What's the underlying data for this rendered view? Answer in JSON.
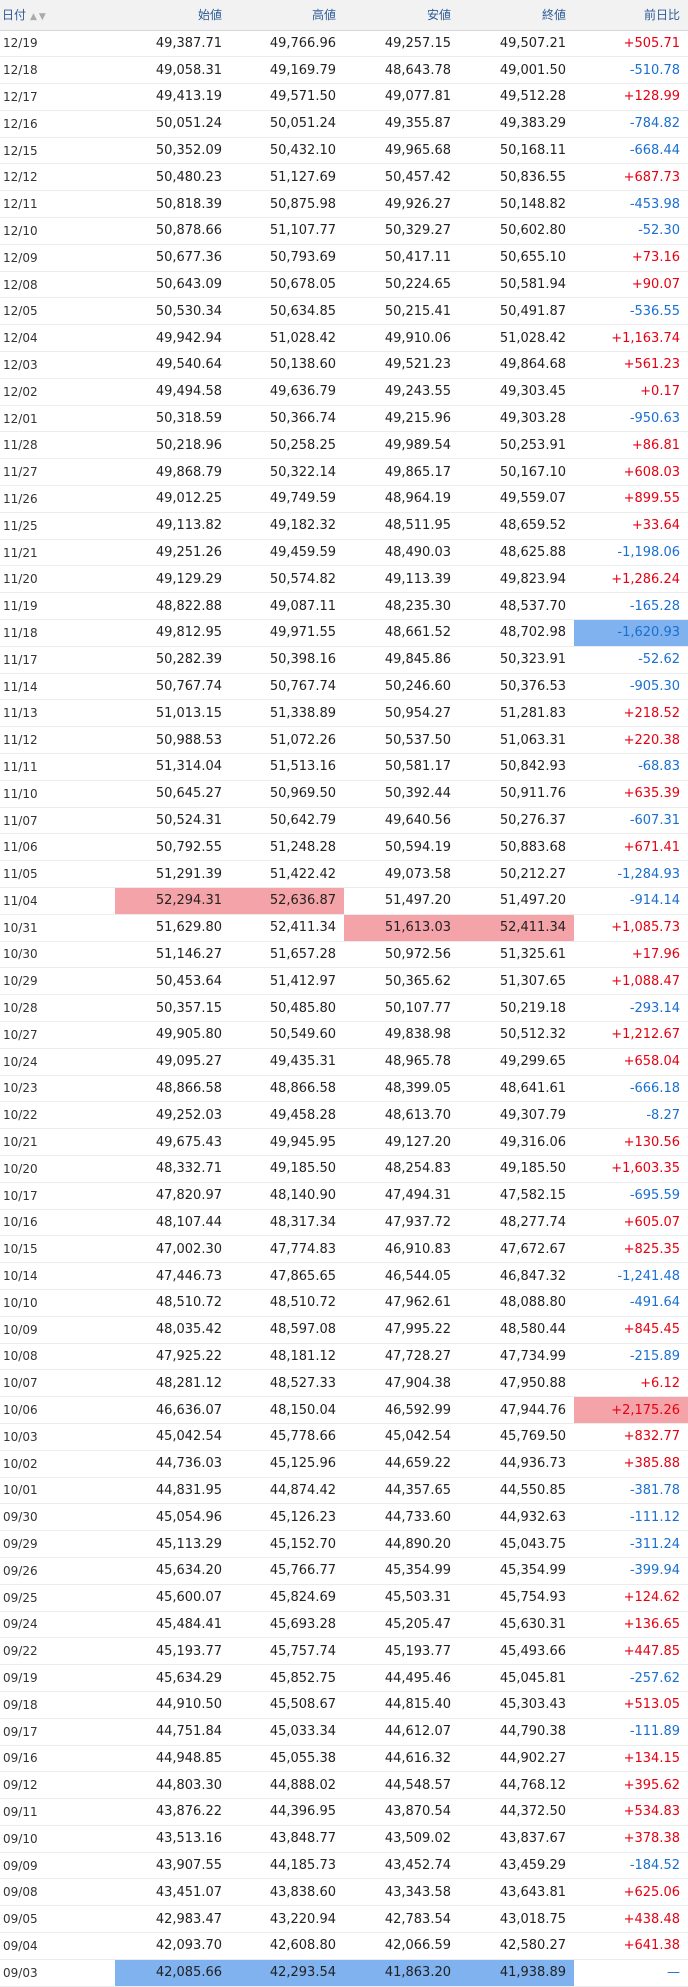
{
  "header": {
    "date": "日付",
    "sort_icon": "sort-up-down-icon",
    "open": "始値",
    "high": "高値",
    "low": "安値",
    "close": "終値",
    "change": "前日比"
  },
  "colors": {
    "positive": "#e60012",
    "negative": "#1a6fd1",
    "highlight_high": "#f4a3a8",
    "highlight_low": "#7fb2ee"
  },
  "rows": [
    {
      "date": "12/19",
      "open": "49,387.71",
      "high": "49,766.96",
      "low": "49,257.15",
      "close": "49,507.21",
      "change": "+505.71"
    },
    {
      "date": "12/18",
      "open": "49,058.31",
      "high": "49,169.79",
      "low": "48,643.78",
      "close": "49,001.50",
      "change": "-510.78"
    },
    {
      "date": "12/17",
      "open": "49,413.19",
      "high": "49,571.50",
      "low": "49,077.81",
      "close": "49,512.28",
      "change": "+128.99"
    },
    {
      "date": "12/16",
      "open": "50,051.24",
      "high": "50,051.24",
      "low": "49,355.87",
      "close": "49,383.29",
      "change": "-784.82"
    },
    {
      "date": "12/15",
      "open": "50,352.09",
      "high": "50,432.10",
      "low": "49,965.68",
      "close": "50,168.11",
      "change": "-668.44"
    },
    {
      "date": "12/12",
      "open": "50,480.23",
      "high": "51,127.69",
      "low": "50,457.42",
      "close": "50,836.55",
      "change": "+687.73"
    },
    {
      "date": "12/11",
      "open": "50,818.39",
      "high": "50,875.98",
      "low": "49,926.27",
      "close": "50,148.82",
      "change": "-453.98"
    },
    {
      "date": "12/10",
      "open": "50,878.66",
      "high": "51,107.77",
      "low": "50,329.27",
      "close": "50,602.80",
      "change": "-52.30"
    },
    {
      "date": "12/09",
      "open": "50,677.36",
      "high": "50,793.69",
      "low": "50,417.11",
      "close": "50,655.10",
      "change": "+73.16"
    },
    {
      "date": "12/08",
      "open": "50,643.09",
      "high": "50,678.05",
      "low": "50,224.65",
      "close": "50,581.94",
      "change": "+90.07"
    },
    {
      "date": "12/05",
      "open": "50,530.34",
      "high": "50,634.85",
      "low": "50,215.41",
      "close": "50,491.87",
      "change": "-536.55"
    },
    {
      "date": "12/04",
      "open": "49,942.94",
      "high": "51,028.42",
      "low": "49,910.06",
      "close": "51,028.42",
      "change": "+1,163.74"
    },
    {
      "date": "12/03",
      "open": "49,540.64",
      "high": "50,138.60",
      "low": "49,521.23",
      "close": "49,864.68",
      "change": "+561.23"
    },
    {
      "date": "12/02",
      "open": "49,494.58",
      "high": "49,636.79",
      "low": "49,243.55",
      "close": "49,303.45",
      "change": "+0.17"
    },
    {
      "date": "12/01",
      "open": "50,318.59",
      "high": "50,366.74",
      "low": "49,215.96",
      "close": "49,303.28",
      "change": "-950.63"
    },
    {
      "date": "11/28",
      "open": "50,218.96",
      "high": "50,258.25",
      "low": "49,989.54",
      "close": "50,253.91",
      "change": "+86.81"
    },
    {
      "date": "11/27",
      "open": "49,868.79",
      "high": "50,322.14",
      "low": "49,865.17",
      "close": "50,167.10",
      "change": "+608.03"
    },
    {
      "date": "11/26",
      "open": "49,012.25",
      "high": "49,749.59",
      "low": "48,964.19",
      "close": "49,559.07",
      "change": "+899.55"
    },
    {
      "date": "11/25",
      "open": "49,113.82",
      "high": "49,182.32",
      "low": "48,511.95",
      "close": "48,659.52",
      "change": "+33.64"
    },
    {
      "date": "11/21",
      "open": "49,251.26",
      "high": "49,459.59",
      "low": "48,490.03",
      "close": "48,625.88",
      "change": "-1,198.06"
    },
    {
      "date": "11/20",
      "open": "49,129.29",
      "high": "50,574.82",
      "low": "49,113.39",
      "close": "49,823.94",
      "change": "+1,286.24"
    },
    {
      "date": "11/19",
      "open": "48,822.88",
      "high": "49,087.11",
      "low": "48,235.30",
      "close": "48,537.70",
      "change": "-165.28"
    },
    {
      "date": "11/18",
      "open": "49,812.95",
      "high": "49,971.55",
      "low": "48,661.52",
      "close": "48,702.98",
      "change": "-1,620.93",
      "hl": {
        "change": "low"
      }
    },
    {
      "date": "11/17",
      "open": "50,282.39",
      "high": "50,398.16",
      "low": "49,845.86",
      "close": "50,323.91",
      "change": "-52.62"
    },
    {
      "date": "11/14",
      "open": "50,767.74",
      "high": "50,767.74",
      "low": "50,246.60",
      "close": "50,376.53",
      "change": "-905.30"
    },
    {
      "date": "11/13",
      "open": "51,013.15",
      "high": "51,338.89",
      "low": "50,954.27",
      "close": "51,281.83",
      "change": "+218.52"
    },
    {
      "date": "11/12",
      "open": "50,988.53",
      "high": "51,072.26",
      "low": "50,537.50",
      "close": "51,063.31",
      "change": "+220.38"
    },
    {
      "date": "11/11",
      "open": "51,314.04",
      "high": "51,513.16",
      "low": "50,581.17",
      "close": "50,842.93",
      "change": "-68.83"
    },
    {
      "date": "11/10",
      "open": "50,645.27",
      "high": "50,969.50",
      "low": "50,392.44",
      "close": "50,911.76",
      "change": "+635.39"
    },
    {
      "date": "11/07",
      "open": "50,524.31",
      "high": "50,642.79",
      "low": "49,640.56",
      "close": "50,276.37",
      "change": "-607.31"
    },
    {
      "date": "11/06",
      "open": "50,792.55",
      "high": "51,248.28",
      "low": "50,594.19",
      "close": "50,883.68",
      "change": "+671.41"
    },
    {
      "date": "11/05",
      "open": "51,291.39",
      "high": "51,422.42",
      "low": "49,073.58",
      "close": "50,212.27",
      "change": "-1,284.93"
    },
    {
      "date": "11/04",
      "open": "52,294.31",
      "high": "52,636.87",
      "low": "51,497.20",
      "close": "51,497.20",
      "change": "-914.14",
      "hl": {
        "open": "high",
        "high": "high"
      }
    },
    {
      "date": "10/31",
      "open": "51,629.80",
      "high": "52,411.34",
      "low": "51,613.03",
      "close": "52,411.34",
      "change": "+1,085.73",
      "hl": {
        "low": "high",
        "close": "high"
      }
    },
    {
      "date": "10/30",
      "open": "51,146.27",
      "high": "51,657.28",
      "low": "50,972.56",
      "close": "51,325.61",
      "change": "+17.96"
    },
    {
      "date": "10/29",
      "open": "50,453.64",
      "high": "51,412.97",
      "low": "50,365.62",
      "close": "51,307.65",
      "change": "+1,088.47"
    },
    {
      "date": "10/28",
      "open": "50,357.15",
      "high": "50,485.80",
      "low": "50,107.77",
      "close": "50,219.18",
      "change": "-293.14"
    },
    {
      "date": "10/27",
      "open": "49,905.80",
      "high": "50,549.60",
      "low": "49,838.98",
      "close": "50,512.32",
      "change": "+1,212.67"
    },
    {
      "date": "10/24",
      "open": "49,095.27",
      "high": "49,435.31",
      "low": "48,965.78",
      "close": "49,299.65",
      "change": "+658.04"
    },
    {
      "date": "10/23",
      "open": "48,866.58",
      "high": "48,866.58",
      "low": "48,399.05",
      "close": "48,641.61",
      "change": "-666.18"
    },
    {
      "date": "10/22",
      "open": "49,252.03",
      "high": "49,458.28",
      "low": "48,613.70",
      "close": "49,307.79",
      "change": "-8.27"
    },
    {
      "date": "10/21",
      "open": "49,675.43",
      "high": "49,945.95",
      "low": "49,127.20",
      "close": "49,316.06",
      "change": "+130.56"
    },
    {
      "date": "10/20",
      "open": "48,332.71",
      "high": "49,185.50",
      "low": "48,254.83",
      "close": "49,185.50",
      "change": "+1,603.35"
    },
    {
      "date": "10/17",
      "open": "47,820.97",
      "high": "48,140.90",
      "low": "47,494.31",
      "close": "47,582.15",
      "change": "-695.59"
    },
    {
      "date": "10/16",
      "open": "48,107.44",
      "high": "48,317.34",
      "low": "47,937.72",
      "close": "48,277.74",
      "change": "+605.07"
    },
    {
      "date": "10/15",
      "open": "47,002.30",
      "high": "47,774.83",
      "low": "46,910.83",
      "close": "47,672.67",
      "change": "+825.35"
    },
    {
      "date": "10/14",
      "open": "47,446.73",
      "high": "47,865.65",
      "low": "46,544.05",
      "close": "46,847.32",
      "change": "-1,241.48"
    },
    {
      "date": "10/10",
      "open": "48,510.72",
      "high": "48,510.72",
      "low": "47,962.61",
      "close": "48,088.80",
      "change": "-491.64"
    },
    {
      "date": "10/09",
      "open": "48,035.42",
      "high": "48,597.08",
      "low": "47,995.22",
      "close": "48,580.44",
      "change": "+845.45"
    },
    {
      "date": "10/08",
      "open": "47,925.22",
      "high": "48,181.12",
      "low": "47,728.27",
      "close": "47,734.99",
      "change": "-215.89"
    },
    {
      "date": "10/07",
      "open": "48,281.12",
      "high": "48,527.33",
      "low": "47,904.38",
      "close": "47,950.88",
      "change": "+6.12"
    },
    {
      "date": "10/06",
      "open": "46,636.07",
      "high": "48,150.04",
      "low": "46,592.99",
      "close": "47,944.76",
      "change": "+2,175.26",
      "hl": {
        "change": "high"
      }
    },
    {
      "date": "10/03",
      "open": "45,042.54",
      "high": "45,778.66",
      "low": "45,042.54",
      "close": "45,769.50",
      "change": "+832.77"
    },
    {
      "date": "10/02",
      "open": "44,736.03",
      "high": "45,125.96",
      "low": "44,659.22",
      "close": "44,936.73",
      "change": "+385.88"
    },
    {
      "date": "10/01",
      "open": "44,831.95",
      "high": "44,874.42",
      "low": "44,357.65",
      "close": "44,550.85",
      "change": "-381.78"
    },
    {
      "date": "09/30",
      "open": "45,054.96",
      "high": "45,126.23",
      "low": "44,733.60",
      "close": "44,932.63",
      "change": "-111.12"
    },
    {
      "date": "09/29",
      "open": "45,113.29",
      "high": "45,152.70",
      "low": "44,890.20",
      "close": "45,043.75",
      "change": "-311.24"
    },
    {
      "date": "09/26",
      "open": "45,634.20",
      "high": "45,766.77",
      "low": "45,354.99",
      "close": "45,354.99",
      "change": "-399.94"
    },
    {
      "date": "09/25",
      "open": "45,600.07",
      "high": "45,824.69",
      "low": "45,503.31",
      "close": "45,754.93",
      "change": "+124.62"
    },
    {
      "date": "09/24",
      "open": "45,484.41",
      "high": "45,693.28",
      "low": "45,205.47",
      "close": "45,630.31",
      "change": "+136.65"
    },
    {
      "date": "09/22",
      "open": "45,193.77",
      "high": "45,757.74",
      "low": "45,193.77",
      "close": "45,493.66",
      "change": "+447.85"
    },
    {
      "date": "09/19",
      "open": "45,634.29",
      "high": "45,852.75",
      "low": "44,495.46",
      "close": "45,045.81",
      "change": "-257.62"
    },
    {
      "date": "09/18",
      "open": "44,910.50",
      "high": "45,508.67",
      "low": "44,815.40",
      "close": "45,303.43",
      "change": "+513.05"
    },
    {
      "date": "09/17",
      "open": "44,751.84",
      "high": "45,033.34",
      "low": "44,612.07",
      "close": "44,790.38",
      "change": "-111.89"
    },
    {
      "date": "09/16",
      "open": "44,948.85",
      "high": "45,055.38",
      "low": "44,616.32",
      "close": "44,902.27",
      "change": "+134.15"
    },
    {
      "date": "09/12",
      "open": "44,803.30",
      "high": "44,888.02",
      "low": "44,548.57",
      "close": "44,768.12",
      "change": "+395.62"
    },
    {
      "date": "09/11",
      "open": "43,876.22",
      "high": "44,396.95",
      "low": "43,870.54",
      "close": "44,372.50",
      "change": "+534.83"
    },
    {
      "date": "09/10",
      "open": "43,513.16",
      "high": "43,848.77",
      "low": "43,509.02",
      "close": "43,837.67",
      "change": "+378.38"
    },
    {
      "date": "09/09",
      "open": "43,907.55",
      "high": "44,185.73",
      "low": "43,452.74",
      "close": "43,459.29",
      "change": "-184.52"
    },
    {
      "date": "09/08",
      "open": "43,451.07",
      "high": "43,838.60",
      "low": "43,343.58",
      "close": "43,643.81",
      "change": "+625.06"
    },
    {
      "date": "09/05",
      "open": "42,983.47",
      "high": "43,220.94",
      "low": "42,783.54",
      "close": "43,018.75",
      "change": "+438.48"
    },
    {
      "date": "09/04",
      "open": "42,093.70",
      "high": "42,608.80",
      "low": "42,066.59",
      "close": "42,580.27",
      "change": "+641.38"
    },
    {
      "date": "09/03",
      "open": "42,085.66",
      "high": "42,293.54",
      "low": "41,863.20",
      "close": "41,938.89",
      "change": "—",
      "hl": {
        "open": "low",
        "high": "low",
        "low": "low",
        "close": "low"
      }
    }
  ]
}
